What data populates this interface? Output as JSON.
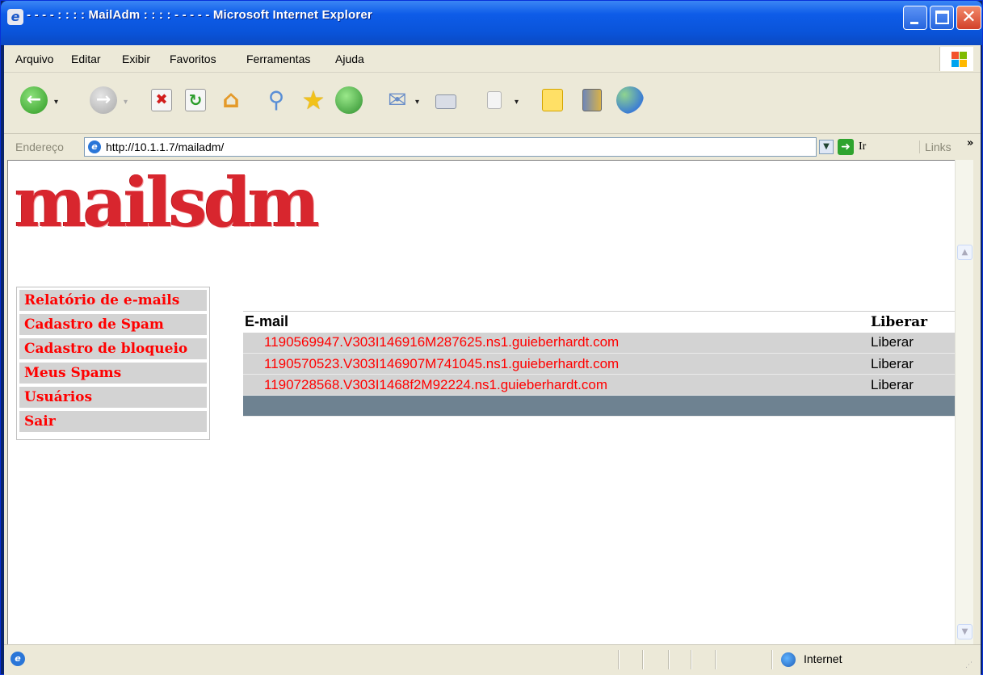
{
  "window": {
    "title": "- - - - : : : : MailAdm : : : : - - - - - Microsoft Internet Explorer"
  },
  "menubar": {
    "items": [
      "Arquivo",
      "Editar",
      "Exibir",
      "Favoritos",
      "Ferramentas",
      "Ajuda"
    ]
  },
  "toolbar": {
    "icons": [
      "back-icon",
      "forward-icon",
      "stop-icon",
      "refresh-icon",
      "home-icon",
      "search-icon",
      "favorites-icon",
      "history-icon",
      "mail-icon",
      "print-icon",
      "edit-icon",
      "discuss-icon",
      "research-icon",
      "messenger-icon"
    ]
  },
  "address": {
    "label": "Endereço",
    "url": "http://10.1.1.7/mailadm/",
    "go_label": "Ir",
    "links_label": "Links",
    "links_chevron": "»"
  },
  "page": {
    "logo_text": "mailsdm",
    "sidebar": [
      "Relatório de e-mails",
      "Cadastro de Spam",
      "Cadastro de bloqueio",
      "Meus Spams",
      "Usuários",
      "Sair"
    ],
    "table": {
      "headers": [
        "E-mail",
        "Liberar"
      ],
      "rows": [
        {
          "email": "1190569947.V303I146916M287625.ns1.guieberhardt.com",
          "action": "Liberar"
        },
        {
          "email": "1190570523.V303I146907M741045.ns1.guieberhardt.com",
          "action": "Liberar"
        },
        {
          "email": "1190728568.V303I1468f2M92224.ns1.guieberhardt.com",
          "action": "Liberar"
        }
      ]
    }
  },
  "status": {
    "zone": "Internet"
  },
  "colors": {
    "titlebar": "#0a54da",
    "menu_text": "#ff0000",
    "row_bg": "#d3d3d3",
    "footer_bg": "#6e8291",
    "logo": "#d8262e"
  }
}
